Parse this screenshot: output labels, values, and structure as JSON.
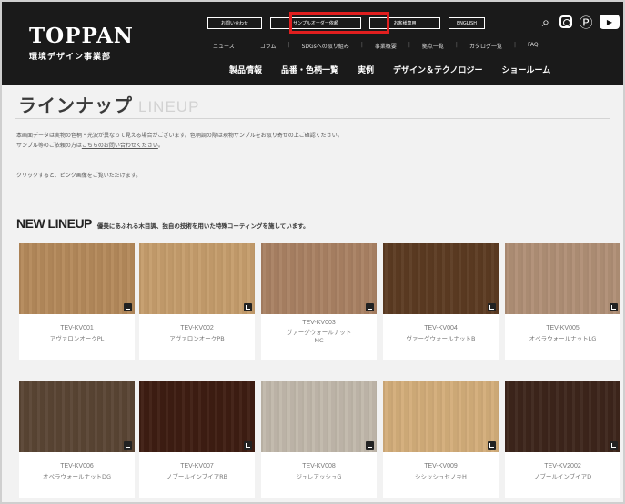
{
  "header": {
    "brand_main": "TOPPAN",
    "brand_sub": "環境デザイン事業部",
    "util_buttons": [
      "お問い合わせ",
      "サンプルオーダー依頼",
      "お客様専用",
      "ENGLISH"
    ],
    "subnav": [
      "ニュース",
      "コラム",
      "SDGsへの取り組み",
      "事業概要",
      "拠点一覧",
      "カタログ一覧",
      "FAQ"
    ],
    "mainnav": [
      "製品情報",
      "品番・色柄一覧",
      "実例",
      "デザイン＆テクノロジー",
      "ショールーム"
    ]
  },
  "page": {
    "title": "ラインナップ",
    "title_en": "LINEUP",
    "intro_line1": "本画面データは実物の色柄・光沢が異なって見える場合がございます。色柄調の際は現物サンプルをお取り寄せの上ご確認ください。",
    "intro_line2_prefix": "サンプル等のご依頼の方は",
    "intro_line2_link": "こちらのお問い合わせください",
    "intro_line2_suffix": "。",
    "intro_line3": "クリックすると、ピンク画像をご覧いただけます。",
    "newlineup_title": "NEW LINEUP",
    "newlineup_desc": "優美にあふれる木目調、独自の技術を用いた特殊コーティングを施しています。"
  },
  "products": [
    {
      "code": "TEV-KV001",
      "name": "アヴァロンオーク",
      "name2": "PL"
    },
    {
      "code": "TEV-KV002",
      "name": "アヴァロンオーク",
      "name2": "PB"
    },
    {
      "code": "TEV-KV003",
      "name": "ヴァーグウォールナット",
      "name2": "MC"
    },
    {
      "code": "TEV-KV004",
      "name": "ヴァーグウォールナット",
      "name2": "B"
    },
    {
      "code": "TEV-KV005",
      "name": "オペラウォールナット",
      "name2": "LG"
    },
    {
      "code": "TEV-KV006",
      "name": "オペラウォールナット",
      "name2": "DG"
    },
    {
      "code": "TEV-KV007",
      "name": "ノブールインブイアRB",
      "name2": ""
    },
    {
      "code": "TEV-KV008",
      "name": "ジュレアッシュG",
      "name2": ""
    },
    {
      "code": "TEV-KV009",
      "name": "シシッシュセノキ",
      "name2": "H"
    },
    {
      "code": "TEV-KV2002",
      "name": "ノブールインブイアD",
      "name2": ""
    }
  ],
  "colors": {
    "header_bg": "#1a1a1a",
    "highlight": "#e01f1f",
    "swatches": [
      "#b4895b",
      "#c59d6c",
      "#a98163",
      "#5c3b22",
      "#b08f76",
      "#5a4534",
      "#3e1d12",
      "#c1b8ab",
      "#d3ad7a",
      "#3d251b"
    ]
  },
  "icons": [
    "search-icon",
    "instagram-icon",
    "pinterest-icon",
    "youtube-icon",
    "enlarge-icon"
  ]
}
